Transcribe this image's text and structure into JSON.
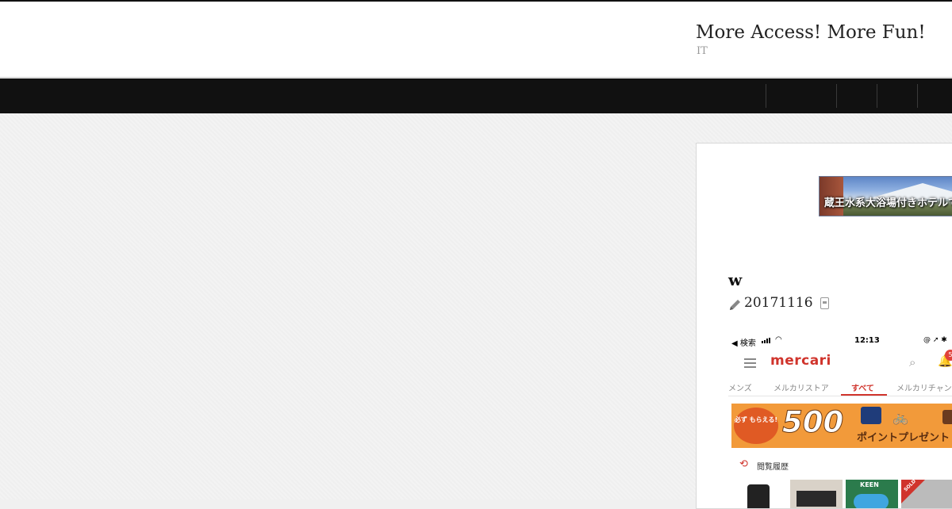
{
  "header": {
    "site_title": "More Access! More Fun!",
    "tagline": "IT"
  },
  "nav": {
    "items_count_visible": 4
  },
  "ad": {
    "text": "蔵王水系大浴場付きホテルでゆったり"
  },
  "post": {
    "title": "w",
    "date": "20171116",
    "icons": [
      "pencil-icon",
      "document-icon"
    ]
  },
  "phone_screenshot": {
    "status": {
      "back_label": "検索",
      "time": "12:13"
    },
    "brand": "mercari",
    "notification_count": "5",
    "tabs": [
      "メンズ",
      "メルカリストア",
      "すべて",
      "メルカリチャン"
    ],
    "active_tab": "すべて",
    "promo": {
      "badge": "必ず もらえる!",
      "number": "500",
      "text": "ポイントプレゼント"
    },
    "history_label": "閲覧履歴",
    "thumbnail_labels": [
      "KEEN",
      "SOLD"
    ]
  },
  "colors": {
    "nav_bg": "#111111",
    "accent": "#d0342c",
    "promo_bg": "#f29a3a"
  }
}
